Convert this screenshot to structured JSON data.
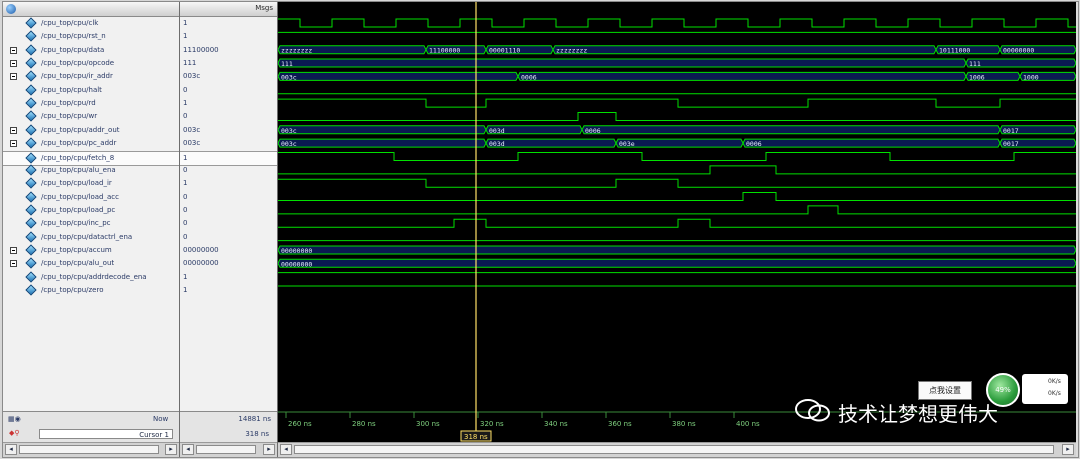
{
  "header": {
    "msgs_label": "Msgs"
  },
  "signals": [
    {
      "name": "/cpu_top/cpu/clk",
      "value": "1",
      "bus": false
    },
    {
      "name": "/cpu_top/cpu/rst_n",
      "value": "1",
      "bus": false
    },
    {
      "name": "/cpu_top/cpu/data",
      "value": "11100000",
      "bus": true
    },
    {
      "name": "/cpu_top/cpu/opcode",
      "value": "111",
      "bus": true
    },
    {
      "name": "/cpu_top/cpu/ir_addr",
      "value": "003c",
      "bus": true
    },
    {
      "name": "/cpu_top/cpu/halt",
      "value": "0",
      "bus": false
    },
    {
      "name": "/cpu_top/cpu/rd",
      "value": "1",
      "bus": false
    },
    {
      "name": "/cpu_top/cpu/wr",
      "value": "0",
      "bus": false
    },
    {
      "name": "/cpu_top/cpu/addr_out",
      "value": "003c",
      "bus": true
    },
    {
      "name": "/cpu_top/cpu/pc_addr",
      "value": "003c",
      "bus": true
    },
    {
      "name": "/cpu_top/cpu/fetch_8",
      "value": "1",
      "bus": false,
      "selected": true
    },
    {
      "name": "/cpu_top/cpu/alu_ena",
      "value": "0",
      "bus": false
    },
    {
      "name": "/cpu_top/cpu/load_ir",
      "value": "1",
      "bus": false
    },
    {
      "name": "/cpu_top/cpu/load_acc",
      "value": "0",
      "bus": false
    },
    {
      "name": "/cpu_top/cpu/load_pc",
      "value": "0",
      "bus": false
    },
    {
      "name": "/cpu_top/cpu/inc_pc",
      "value": "0",
      "bus": false
    },
    {
      "name": "/cpu_top/cpu/datactrl_ena",
      "value": "0",
      "bus": false
    },
    {
      "name": "/cpu_top/cpu/accum",
      "value": "00000000",
      "bus": true
    },
    {
      "name": "/cpu_top/cpu/alu_out",
      "value": "00000000",
      "bus": true
    },
    {
      "name": "/cpu_top/cpu/addrdecode_ena",
      "value": "1",
      "bus": false
    },
    {
      "name": "/cpu_top/cpu/zero",
      "value": "1",
      "bus": false
    }
  ],
  "bottom": {
    "now_label": "Now",
    "now_value": "14881 ns",
    "cursor_label": "Cursor 1",
    "cursor_value": "318 ns",
    "cursor_marker": "318 ns",
    "ticks": [
      "260 ns",
      "280 ns",
      "300 ns",
      "320 ns",
      "340 ns",
      "360 ns",
      "380 ns",
      "400 ns"
    ]
  },
  "bus_labels": {
    "data": [
      "zzzzzzzz",
      "11100000",
      "00001110",
      "zzzzzzzz",
      "10111000",
      "00000000"
    ],
    "opcode": [
      "111",
      "111"
    ],
    "ir_addr": [
      "003c",
      "0006",
      "1006",
      "1000"
    ],
    "addr_out": [
      "003c",
      "003d",
      "0006",
      "0017"
    ],
    "pc_addr": [
      "003c",
      "003d",
      "003e",
      "0006",
      "0017"
    ],
    "accum": [
      "00000000"
    ],
    "alu_out": [
      "00000000"
    ]
  },
  "overlay": {
    "watermark": "技术让梦想更伟大",
    "popup_label": "点我设置",
    "badge_value": "49%",
    "speed_up": "0K/s",
    "speed_down": "0K/s"
  },
  "colors": {
    "wave": "#00e000",
    "cursor": "#ffe066",
    "bus_fill": "#0a1a52",
    "bus_text": "#e8f0ff"
  }
}
